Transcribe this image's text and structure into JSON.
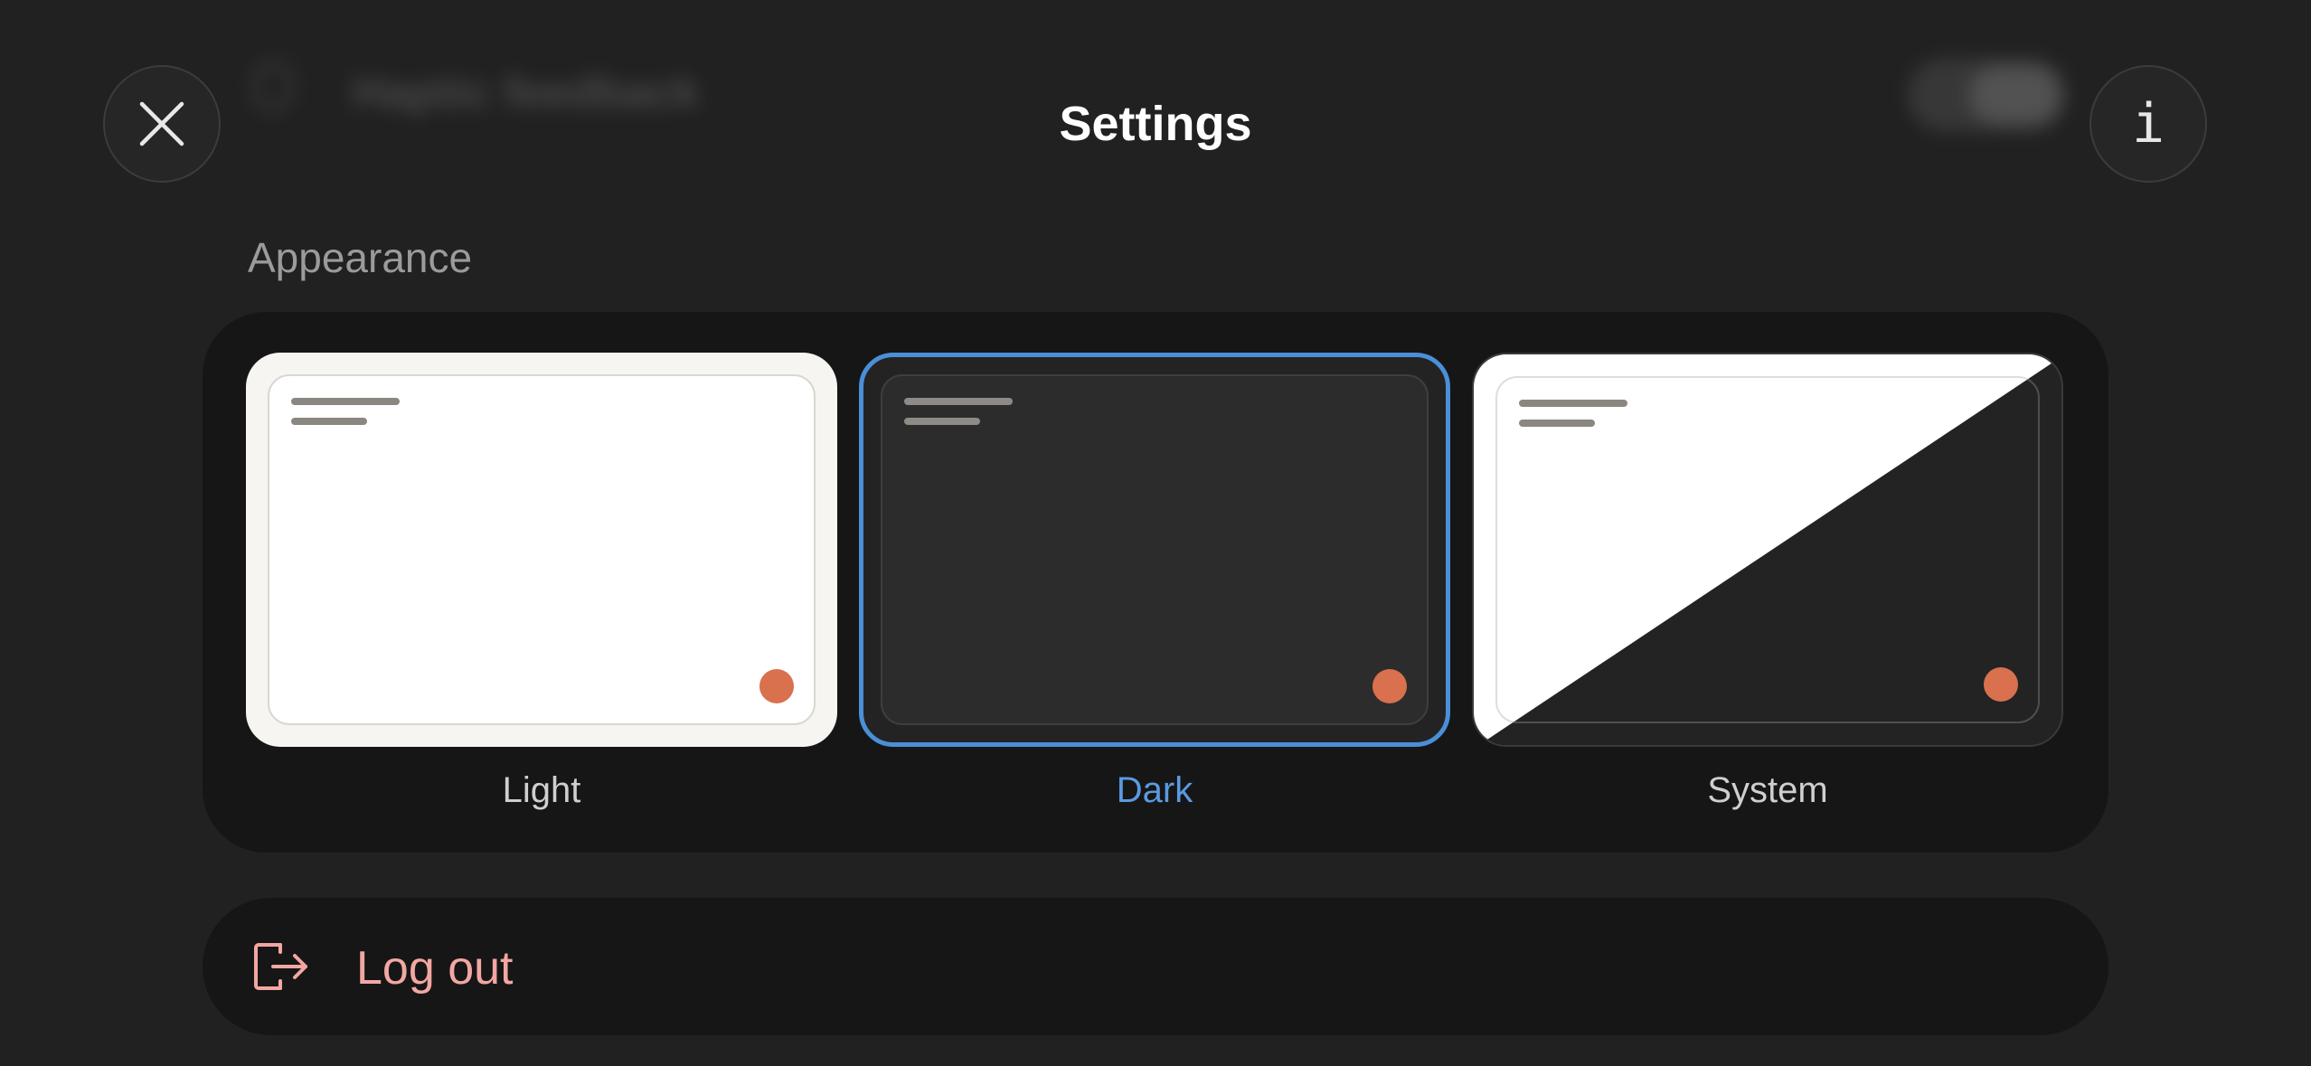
{
  "header": {
    "title": "Settings",
    "info_glyph": "i"
  },
  "background_row": {
    "label": "Haptic feedback"
  },
  "appearance": {
    "section_title": "Appearance",
    "options": [
      {
        "label": "Light",
        "selected": false
      },
      {
        "label": "Dark",
        "selected": true
      },
      {
        "label": "System",
        "selected": false
      }
    ]
  },
  "logout": {
    "label": "Log out"
  },
  "colors": {
    "background": "#212121",
    "card": "#161616",
    "selected_accent": "#4a8fd8",
    "dot_accent": "#d9704e",
    "logout_text": "#f2a7a3"
  },
  "icons": {
    "close": "close-icon",
    "info": "info-icon",
    "logout": "logout-icon"
  }
}
